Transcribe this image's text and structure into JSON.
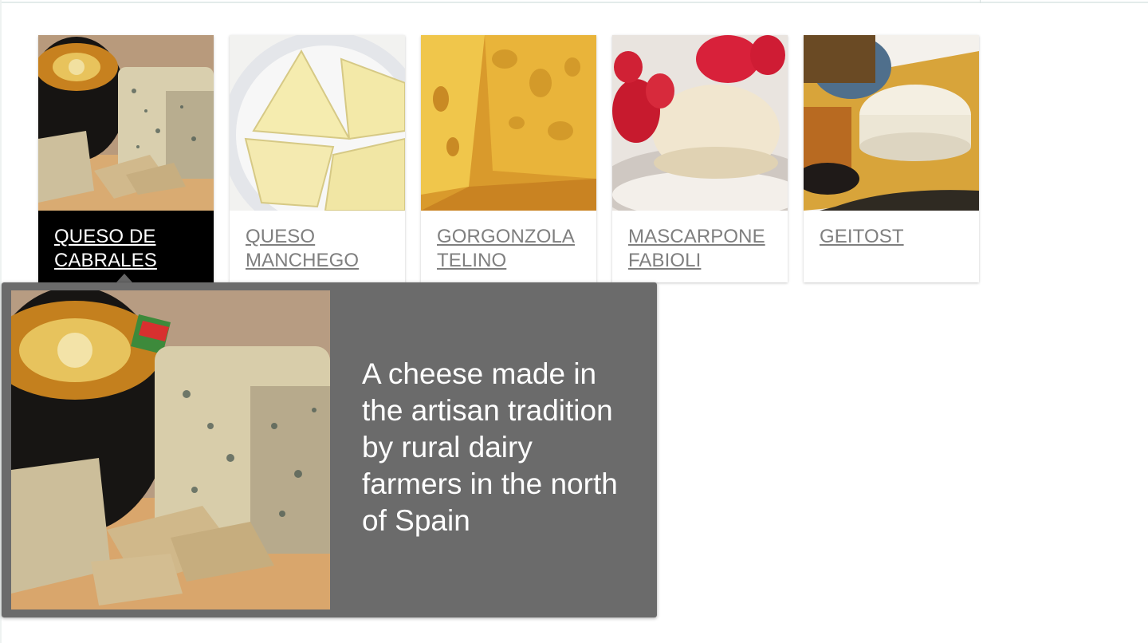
{
  "cheeses": [
    {
      "name": "QUESO DE CABRALES",
      "state": "active"
    },
    {
      "name": "QUESO MANCHEGO",
      "state": "default"
    },
    {
      "name": "GORGONZOLA TELINO",
      "state": "default"
    },
    {
      "name": "MASCARPONE FABIOLI",
      "state": "default"
    },
    {
      "name": "GEITOST",
      "state": "default"
    }
  ],
  "popover": {
    "cheese": "QUESO DE CABRALES",
    "description": "A cheese made in the artisan tradition by rural dairy farmers in the north of Spain"
  },
  "colors": {
    "caption_link": "#7f7f7f",
    "active_caption_bg": "#000000",
    "popover_bg": "#666666"
  }
}
